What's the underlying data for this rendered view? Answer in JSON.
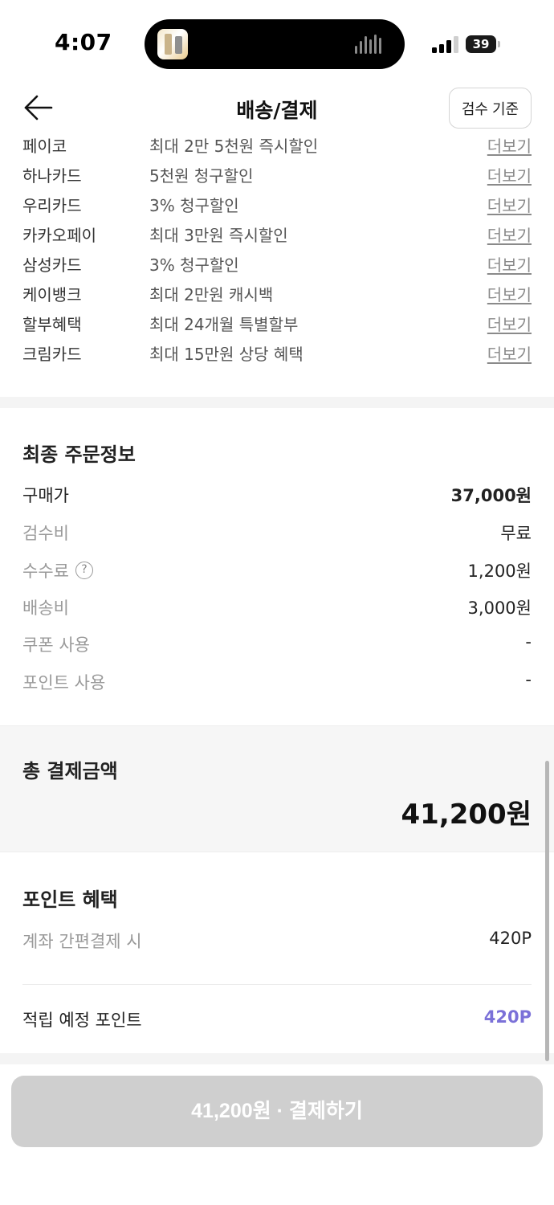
{
  "status_bar": {
    "time": "4:07",
    "battery": "39"
  },
  "header": {
    "title": "배송/결제",
    "inspection_button": "검수 기준"
  },
  "benefits": {
    "more_label": "더보기",
    "items": [
      {
        "name": "페이코",
        "desc": "최대 2만 5천원 즉시할인"
      },
      {
        "name": "하나카드",
        "desc": "5천원 청구할인"
      },
      {
        "name": "우리카드",
        "desc": "3% 청구할인"
      },
      {
        "name": "카카오페이",
        "desc": "최대 3만원 즉시할인"
      },
      {
        "name": "삼성카드",
        "desc": "3% 청구할인"
      },
      {
        "name": "케이뱅크",
        "desc": "최대 2만원 캐시백"
      },
      {
        "name": "할부혜택",
        "desc": "최대 24개월 특별할부"
      },
      {
        "name": "크림카드",
        "desc": "최대 15만원 상당 혜택"
      }
    ]
  },
  "order": {
    "title": "최종 주문정보",
    "rows": [
      {
        "label": "구매가",
        "value": "37,000원"
      },
      {
        "label": "검수비",
        "value": "무료"
      },
      {
        "label": "수수료",
        "value": "1,200원"
      },
      {
        "label": "배송비",
        "value": "3,000원"
      },
      {
        "label": "쿠폰 사용",
        "value": "-"
      },
      {
        "label": "포인트 사용",
        "value": "-"
      }
    ],
    "help_glyph": "?"
  },
  "total": {
    "label": "총 결제금액",
    "amount": "41,200원"
  },
  "points": {
    "title": "포인트 혜택",
    "account_label": "계좌 간편결제 시",
    "account_value": "420P",
    "expected_label": "적립 예정 포인트",
    "expected_value": "420P",
    "accent_color": "#7b71d8"
  },
  "pay_button": {
    "label": "41,200원 · 결제하기",
    "enabled": false
  }
}
